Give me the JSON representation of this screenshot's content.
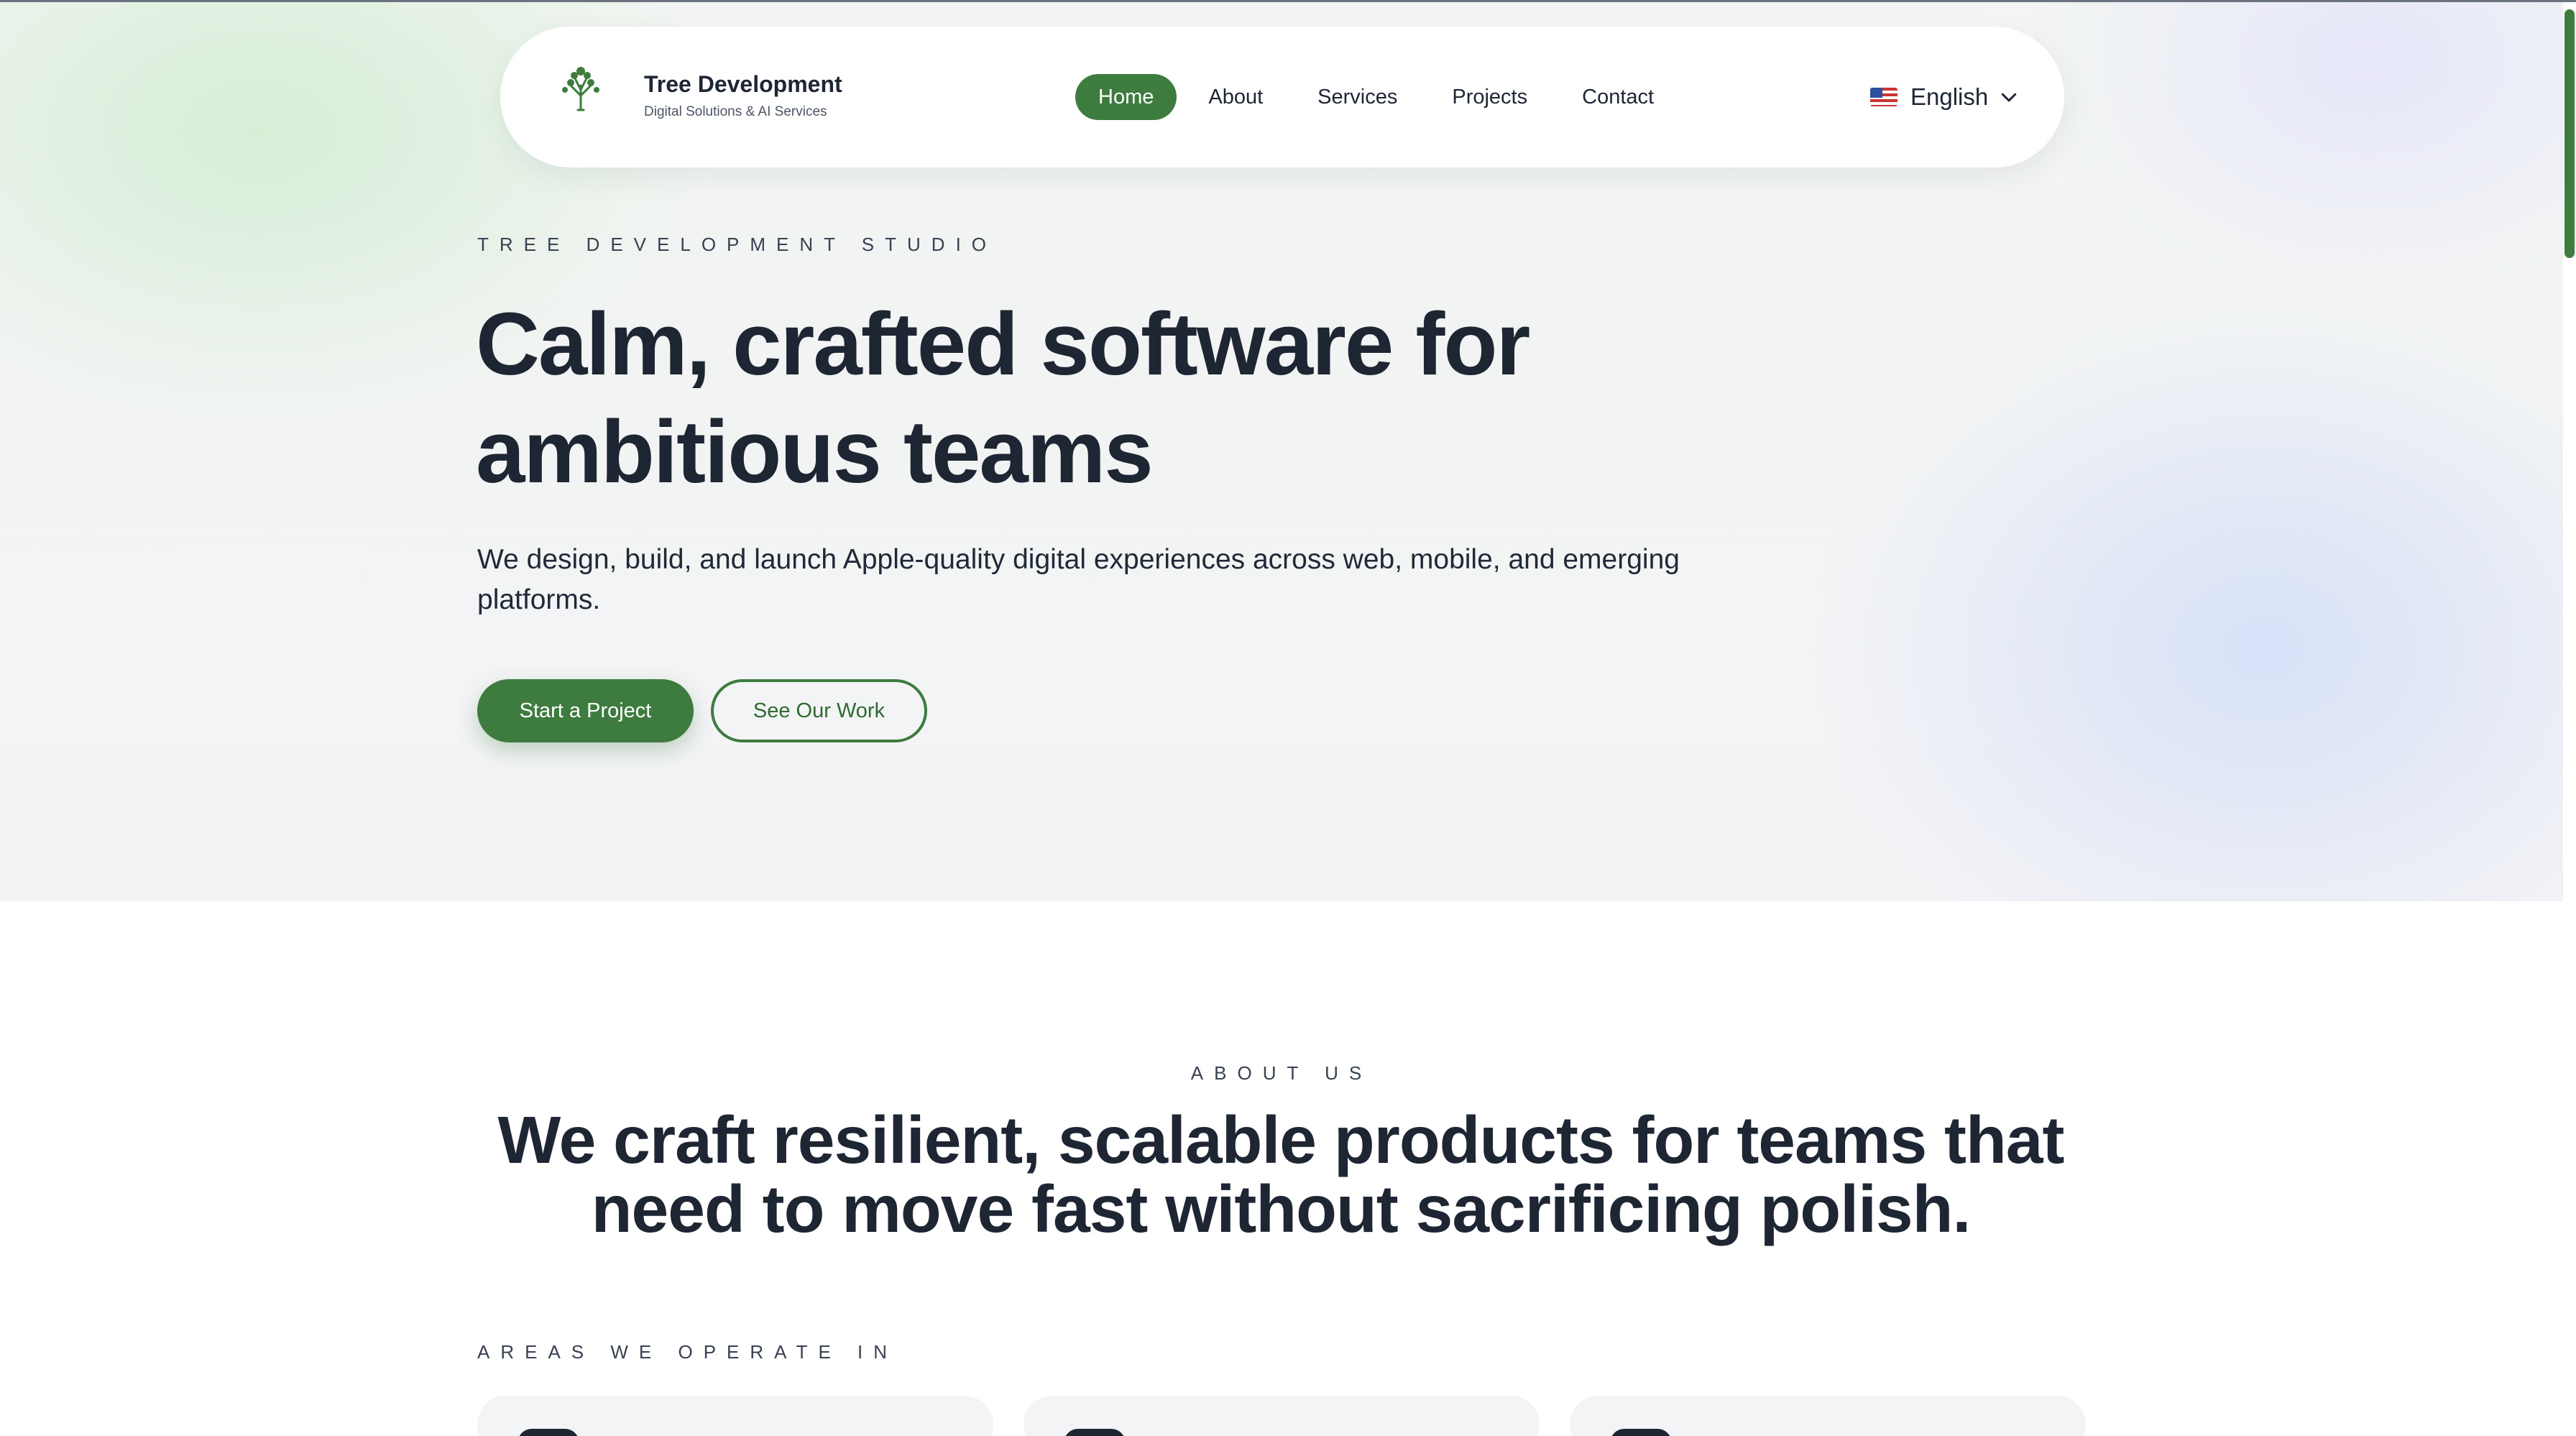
{
  "brand": {
    "name": "Tree Development",
    "tagline": "Digital Solutions & AI Services",
    "icon": "tree-logo-icon"
  },
  "nav": {
    "items": [
      {
        "label": "Home",
        "active": true
      },
      {
        "label": "About",
        "active": false
      },
      {
        "label": "Services",
        "active": false
      },
      {
        "label": "Projects",
        "active": false
      },
      {
        "label": "Contact",
        "active": false
      }
    ]
  },
  "language": {
    "label": "English",
    "flag_icon": "us-flag-icon",
    "chevron_icon": "chevron-down-icon"
  },
  "hero": {
    "eyebrow": "TREE DEVELOPMENT STUDIO",
    "headline": "Calm, crafted software for ambitious teams",
    "subtext": "We design, build, and launch Apple-quality digital experiences across web, mobile, and emerging platforms.",
    "primary_cta": "Start a Project",
    "secondary_cta": "See Our Work"
  },
  "about": {
    "eyebrow": "ABOUT US",
    "title": "We craft resilient, scalable products for teams that need to move fast without sacrificing polish.",
    "areas_label": "AREAS WE OPERATE IN"
  },
  "colors": {
    "accent": "#3e7b3e",
    "text": "#1e2634",
    "card_bg": "#f3f4f6"
  }
}
